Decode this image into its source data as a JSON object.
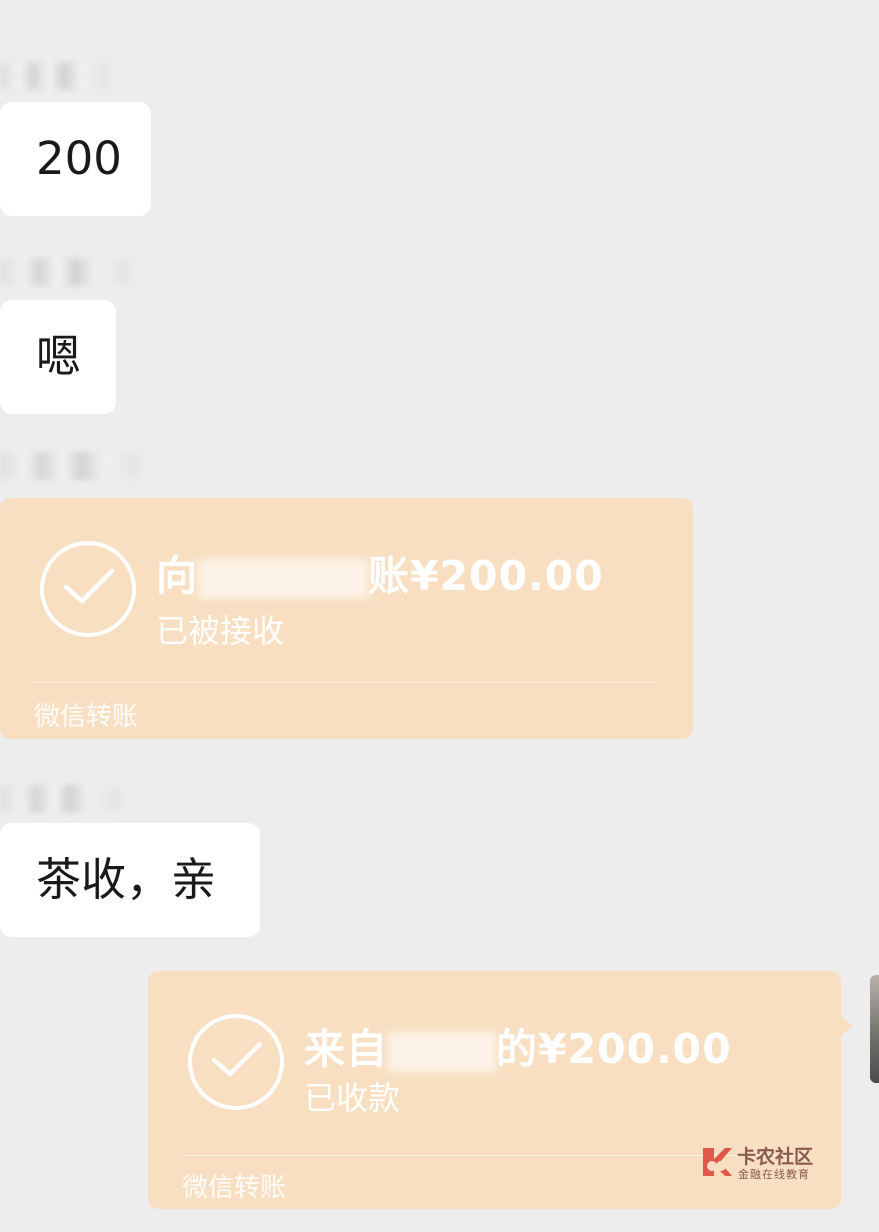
{
  "messages": {
    "m1": {
      "text": "200"
    },
    "m2": {
      "text": "嗯"
    },
    "m3": {
      "title_prefix": "向",
      "title_suffix": "账¥200.00",
      "status": "已被接收",
      "footer": "微信转账"
    },
    "m4": {
      "text": "茶收，亲"
    },
    "m5": {
      "title_prefix": "来自",
      "title_suffix": "的¥200.00",
      "status": "已收款",
      "footer": "微信转账"
    }
  },
  "watermark": {
    "title": "卡农社区",
    "subtitle": "金融在线教育"
  },
  "colors": {
    "background": "#ededed",
    "bubble": "#ffffff",
    "transfer_card": "#f8dfc2"
  }
}
